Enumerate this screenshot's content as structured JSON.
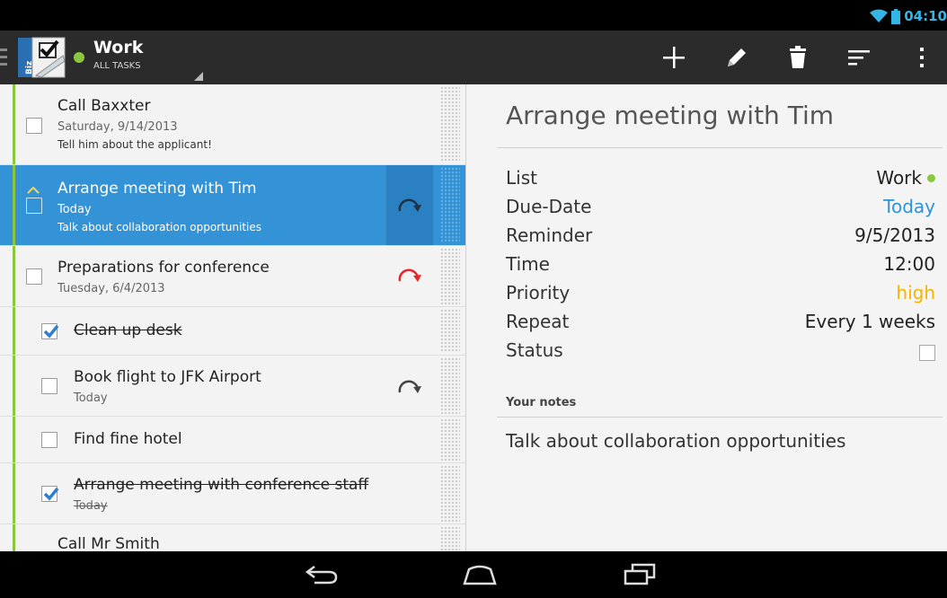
{
  "status_bar": {
    "time": "04:10",
    "icons": [
      "wifi-icon",
      "battery-icon"
    ]
  },
  "action_bar": {
    "list_name": "Work",
    "filter": "ALL TASKS",
    "app_icon_text": "Biz",
    "actions": [
      "add-icon",
      "edit-icon",
      "delete-icon",
      "sort-icon",
      "overflow-icon"
    ]
  },
  "tasks": [
    {
      "title": "Call Baxxter",
      "date": "Saturday, 9/14/2013",
      "note": "Tell him about the applicant!",
      "checked": false,
      "repeat": "none"
    },
    {
      "title": "Arrange meeting with Tim",
      "date": "Today",
      "note": "Talk about collaboration opportunities",
      "checked": false,
      "repeat": "grey",
      "selected": true
    },
    {
      "title": "Preparations for conference",
      "date": "Tuesday, 6/4/2013",
      "note": "",
      "checked": false,
      "repeat": "red"
    },
    {
      "title": "Clean up desk",
      "date": "",
      "note": "",
      "checked": true,
      "repeat": "none"
    },
    {
      "title": "Book flight to JFK Airport",
      "date": "Today",
      "note": "",
      "checked": false,
      "repeat": "grey"
    },
    {
      "title": "Find fine hotel",
      "date": "",
      "note": "",
      "checked": false,
      "repeat": "none"
    },
    {
      "title": "Arrange meeting with conference staff",
      "date": "Today",
      "note": "",
      "checked": true,
      "repeat": "none"
    },
    {
      "title": "Call Mr Smith",
      "date": "",
      "note": "",
      "checked": false,
      "repeat": "none"
    }
  ],
  "detail": {
    "title": "Arrange meeting with Tim",
    "fields": {
      "list": {
        "label": "List",
        "value": "Work"
      },
      "due": {
        "label": "Due-Date",
        "value": "Today"
      },
      "reminder": {
        "label": "Reminder",
        "value": "9/5/2013"
      },
      "time": {
        "label": "Time",
        "value": "12:00"
      },
      "priority": {
        "label": "Priority",
        "value": "high"
      },
      "repeat": {
        "label": "Repeat",
        "value": "Every 1 weeks"
      },
      "status": {
        "label": "Status",
        "checked": false
      }
    },
    "notes_label": "Your notes",
    "notes": "Talk about collaboration opportunities"
  },
  "colors": {
    "accent": "#33b5e5",
    "selected": "#3393d6",
    "list_green": "#8cc63f",
    "priority_high": "#f4b400",
    "repeat_red": "#e8252b"
  },
  "nav_bar": [
    "back-icon",
    "home-icon",
    "recent-apps-icon"
  ]
}
